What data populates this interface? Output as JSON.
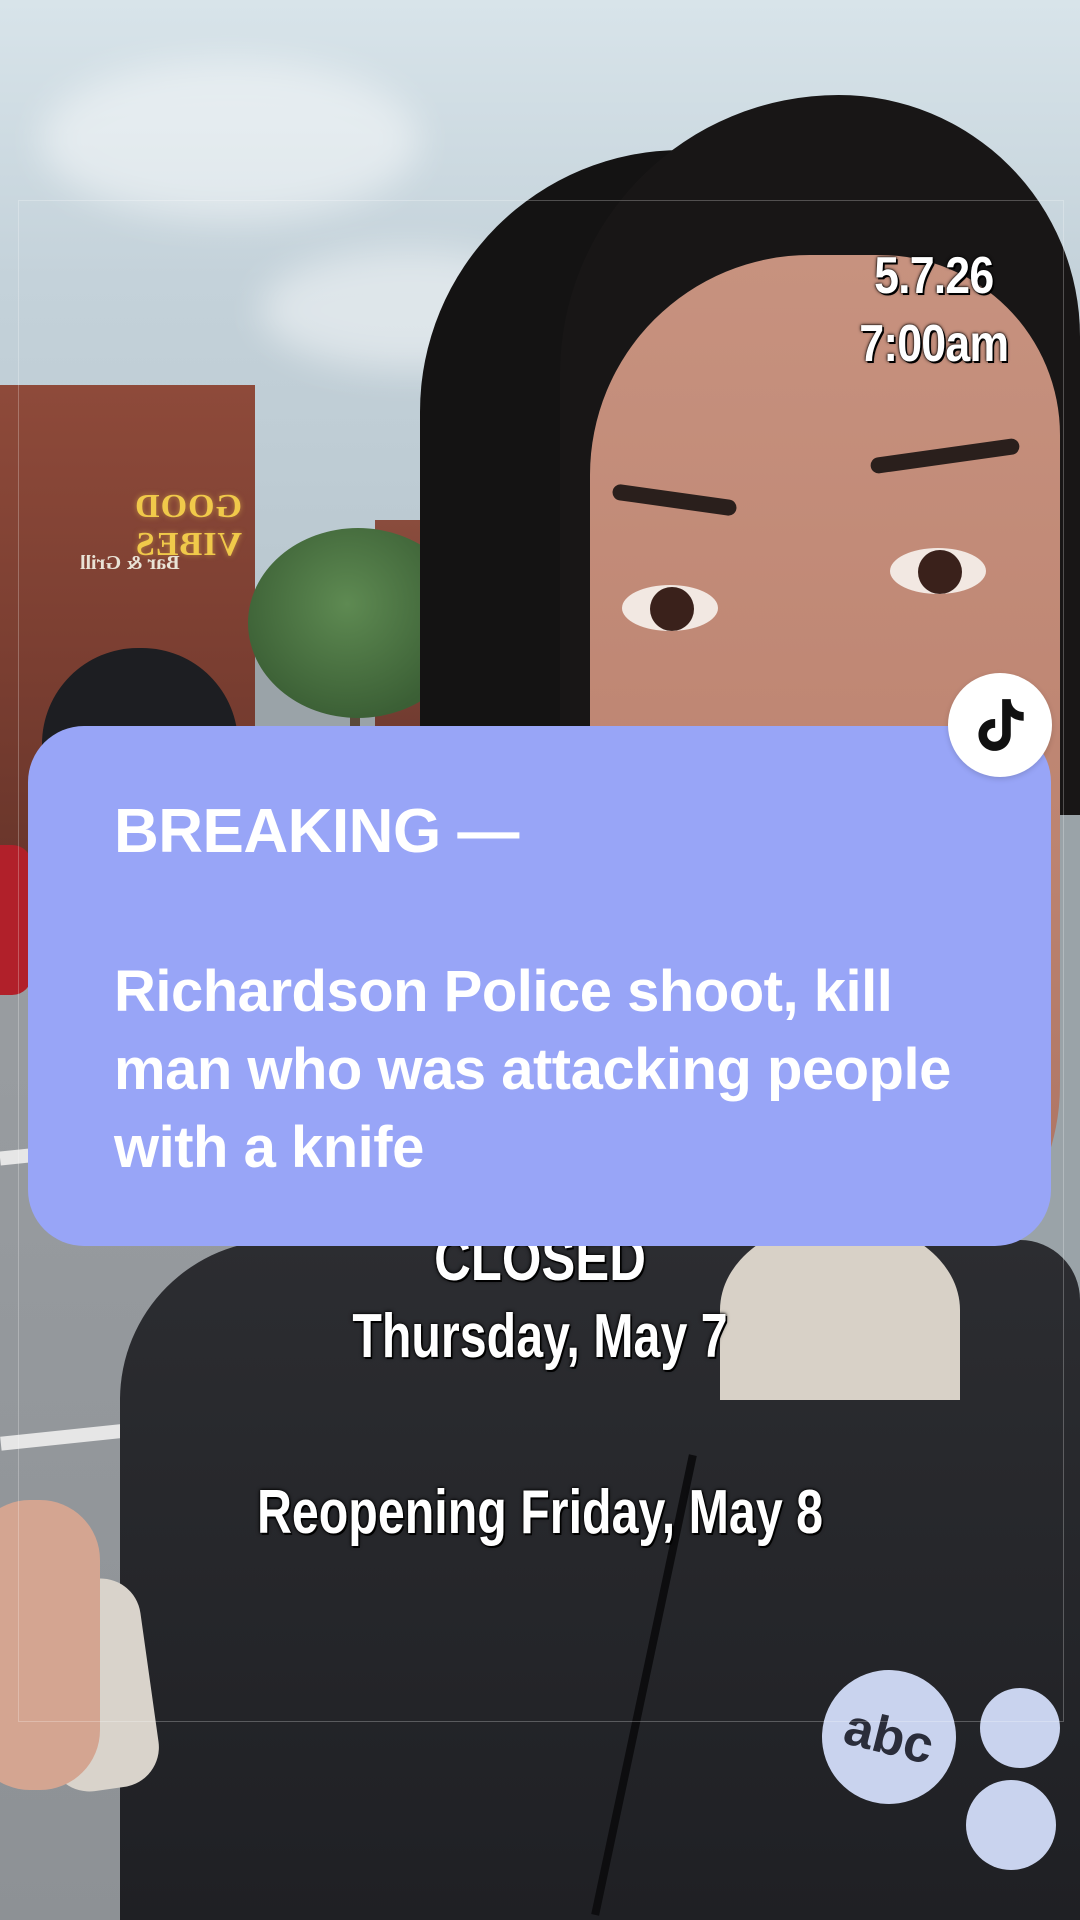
{
  "overlay": {
    "date": "5.7.26",
    "time": "7:00am",
    "closed_label": "CLOSED",
    "closed_date": "Thursday, May 7",
    "reopening": "Reopening Friday, May 8"
  },
  "breaking_card": {
    "label": "BREAKING —",
    "headline": "Richardson Police shoot, kill man who was attacking people with a knife",
    "background_color": "#98a5f7"
  },
  "background": {
    "sign_text": "GOOD VIBES",
    "sign_subtext": "Bar & Grill",
    "jacket_logo": "abc"
  },
  "icons": {
    "tiktok_badge": "tiktok-logo-icon"
  }
}
